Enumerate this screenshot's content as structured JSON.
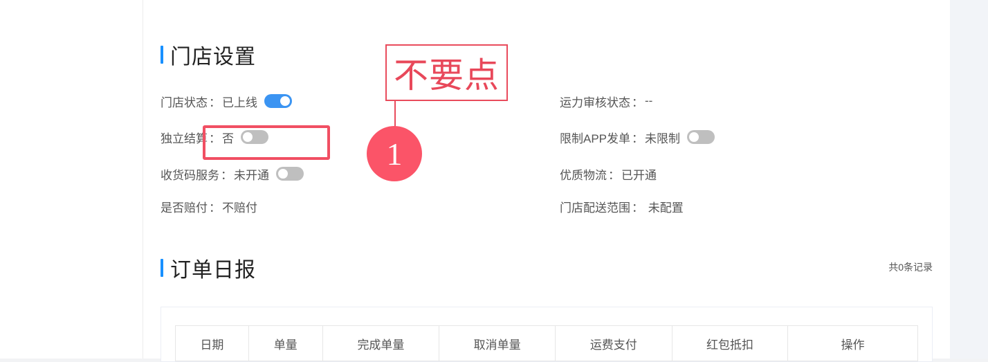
{
  "store_settings": {
    "title": "门店设置",
    "store_status": {
      "label": "门店状态",
      "value": "已上线",
      "enabled": true
    },
    "independent_settlement": {
      "label": "独立结算",
      "value": "否",
      "enabled": false
    },
    "receipt_code_service": {
      "label": "收货码服务",
      "value": "未开通",
      "enabled": false
    },
    "compensation": {
      "label": "是否赔付",
      "value": "不赔付"
    },
    "capacity_review": {
      "label": "运力审核状态",
      "value": "--"
    },
    "limit_app_orders": {
      "label": "限制APP发单",
      "value": "未限制",
      "enabled": false
    },
    "quality_logistics": {
      "label": "优质物流",
      "value": "已开通"
    },
    "delivery_range": {
      "label": "门店配送范围",
      "value": " 未配置"
    }
  },
  "order_daily": {
    "title": "订单日报",
    "record_count": "共0条记录",
    "columns": [
      "日期",
      "单量",
      "完成单量",
      "取消单量",
      "运费支付",
      "红包抵扣",
      "操作"
    ]
  },
  "annotation": {
    "callout_text": "不要点",
    "marker_number": "1",
    "color": "#f14f63"
  },
  "colors": {
    "accent": "#1890ff",
    "toggle_on": "#3b94f2",
    "toggle_off": "#bfbfbf"
  },
  "separator": "："
}
